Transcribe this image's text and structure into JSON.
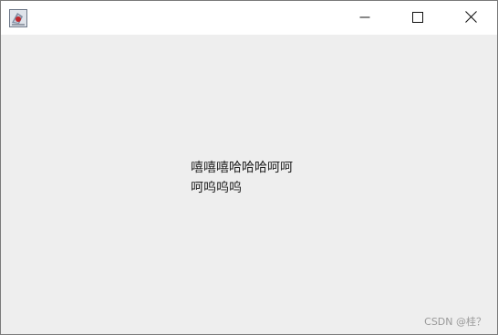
{
  "window": {
    "title": "",
    "controls": {
      "minimize_icon": "minimize-icon",
      "maximize_icon": "maximize-icon",
      "close_icon": "close-icon"
    }
  },
  "content": {
    "lines": [
      "嘻嘻嘻哈哈哈呵呵",
      "呵呜呜呜"
    ]
  },
  "watermark": {
    "text": "CSDN @桂？"
  },
  "colors": {
    "titlebar_bg": "#ffffff",
    "content_bg": "#eeeeee",
    "text": "#222222",
    "watermark": "#9a9a9a"
  }
}
